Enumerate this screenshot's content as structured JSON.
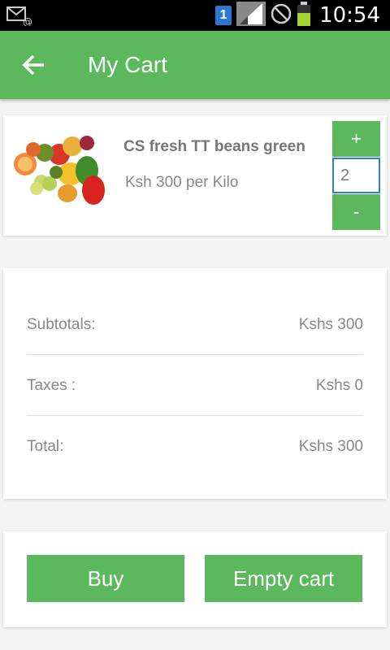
{
  "status_bar": {
    "notification_badge": "1",
    "clock": "10:54",
    "icons": [
      "email-icon",
      "sim-badge-icon",
      "signal-icon",
      "blocked-icon",
      "battery-icon"
    ]
  },
  "app_bar": {
    "title": "My Cart",
    "back_icon": "arrow-left-icon",
    "color": "#5cb85c"
  },
  "cart_item": {
    "name": "CS fresh TT beans green",
    "price": "Ksh 300 per Kilo",
    "quantity": "2",
    "increase_label": "+",
    "decrease_label": "-",
    "image": "fruits-vegetables-image"
  },
  "summary": {
    "subtotal_label": "Subtotals:",
    "subtotal_value": "Kshs 300",
    "taxes_label": "Taxes :",
    "taxes_value": "Kshs 0",
    "total_label": "Total:",
    "total_value": "Kshs 300"
  },
  "actions": {
    "buy_label": "Buy",
    "empty_label": "Empty cart"
  }
}
